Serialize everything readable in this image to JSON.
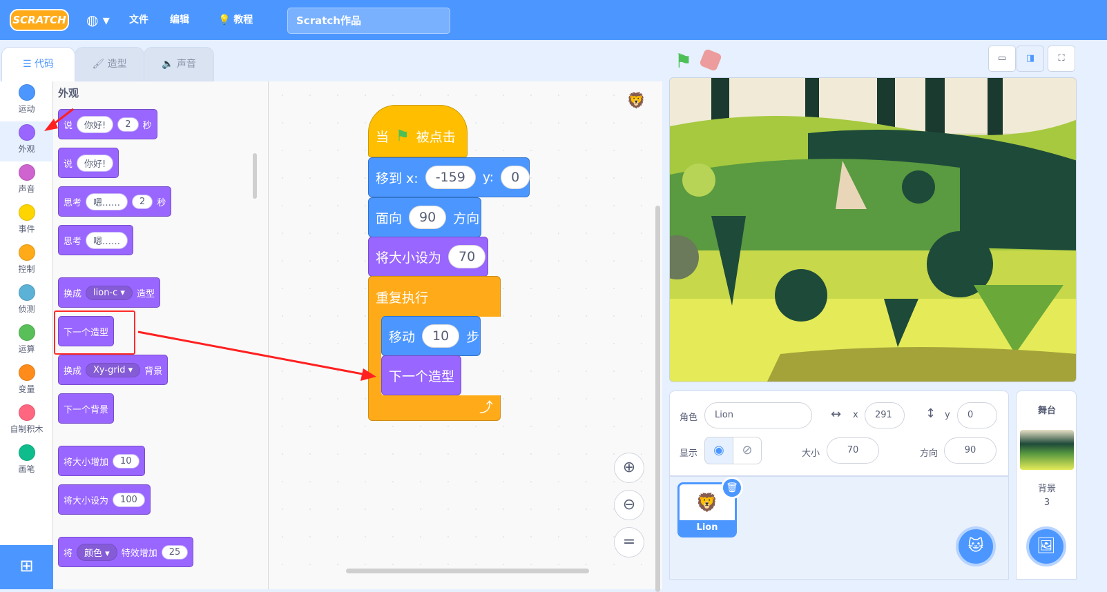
{
  "menubar": {
    "logo": "SCRATCH",
    "file": "文件",
    "edit": "编辑",
    "tutorials": "教程",
    "project_title": "Scratch作品"
  },
  "tabs": {
    "code": "代码",
    "costumes": "造型",
    "sounds": "声音"
  },
  "categories": [
    {
      "label": "运动",
      "color": "#4c97ff"
    },
    {
      "label": "外观",
      "color": "#9966ff"
    },
    {
      "label": "声音",
      "color": "#cf63cf"
    },
    {
      "label": "事件",
      "color": "#ffd500"
    },
    {
      "label": "控制",
      "color": "#ffab19"
    },
    {
      "label": "侦测",
      "color": "#5cb1d6"
    },
    {
      "label": "运算",
      "color": "#59c059"
    },
    {
      "label": "变量",
      "color": "#ff8c1a"
    },
    {
      "label": "自制积木",
      "color": "#ff6680"
    },
    {
      "label": "画笔",
      "color": "#0fbd8c"
    }
  ],
  "palette": {
    "heading": "外观",
    "say_secs": {
      "say": "说",
      "msg": "你好!",
      "secs": "2",
      "unit": "秒"
    },
    "say": {
      "say": "说",
      "msg": "你好!"
    },
    "think_secs": {
      "think": "思考",
      "msg": "嗯……",
      "secs": "2",
      "unit": "秒"
    },
    "think": {
      "think": "思考",
      "msg": "嗯……"
    },
    "switch_costume": {
      "pre": "换成",
      "costume": "lion-c",
      "post": "造型"
    },
    "next_costume": "下一个造型",
    "switch_backdrop": {
      "pre": "换成",
      "backdrop": "Xy-grid",
      "post": "背景"
    },
    "next_backdrop": "下一个背景",
    "change_size": {
      "label": "将大小增加",
      "val": "10"
    },
    "set_size": {
      "label": "将大小设为",
      "val": "100"
    },
    "change_effect": {
      "pre": "将",
      "effect": "颜色",
      "mid": "特效增加",
      "val": "25"
    }
  },
  "script": {
    "when_flag": {
      "pre": "当",
      "post": "被点击"
    },
    "goto": {
      "label": "移到 x:",
      "x": "-159",
      "ylabel": "y:",
      "y": "0"
    },
    "point": {
      "pre": "面向",
      "val": "90",
      "post": "方向"
    },
    "setsize": {
      "label": "将大小设为",
      "val": "70"
    },
    "forever": "重复执行",
    "move": {
      "pre": "移动",
      "val": "10",
      "post": "步"
    },
    "next_costume": "下一个造型"
  },
  "sprite_info": {
    "sprite_label": "角色",
    "sprite_name": "Lion",
    "x_label": "x",
    "x": "291",
    "y_label": "y",
    "y": "0",
    "show_label": "显示",
    "size_label": "大小",
    "size": "70",
    "direction_label": "方向",
    "direction": "90"
  },
  "sprites": [
    {
      "name": "Lion"
    }
  ],
  "stage_panel": {
    "title": "舞台",
    "backdrops_label": "背景",
    "backdrops_count": "3"
  },
  "icons": {
    "zoom_in": "zoom-in-icon",
    "zoom_out": "zoom-out-icon",
    "zoom_reset": "zoom-reset-icon"
  }
}
